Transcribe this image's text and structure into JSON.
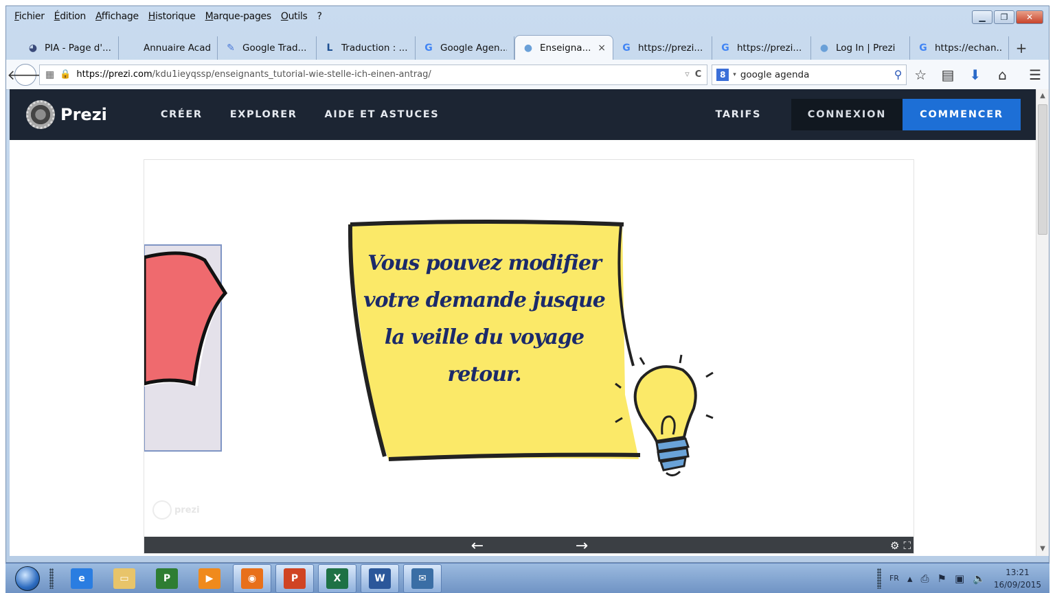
{
  "menubar": {
    "items": [
      "Fichier",
      "Édition",
      "Affichage",
      "Historique",
      "Marque-pages",
      "Outils",
      "?"
    ]
  },
  "tabs": [
    {
      "label": "PIA - Page d'...",
      "icon": "pia-icon",
      "icon_char": "◕",
      "icon_color": "#3a4a7a",
      "active": false
    },
    {
      "label": "Annuaire Acadé...",
      "icon": "none",
      "icon_char": "",
      "icon_color": "#000",
      "active": false
    },
    {
      "label": "Google Trad...",
      "icon": "google-translate-icon",
      "icon_char": "✎",
      "icon_color": "#4a78d8",
      "active": false
    },
    {
      "label": "Traduction : ...",
      "icon": "linguee-icon",
      "icon_char": "L",
      "icon_color": "#1d4f91",
      "active": false
    },
    {
      "label": "Google Agen...",
      "icon": "google-icon",
      "icon_char": "G",
      "icon_color": "#4285f4",
      "active": false
    },
    {
      "label": "Enseigna...",
      "icon": "globe-icon",
      "icon_char": "●",
      "icon_color": "#6aa0d8",
      "active": true
    },
    {
      "label": "https://prezi...",
      "icon": "google-icon",
      "icon_char": "G",
      "icon_color": "#4285f4",
      "active": false
    },
    {
      "label": "https://prezi...",
      "icon": "google-icon",
      "icon_char": "G",
      "icon_color": "#4285f4",
      "active": false
    },
    {
      "label": "Log In | Prezi",
      "icon": "globe-icon",
      "icon_char": "●",
      "icon_color": "#6aa0d8",
      "active": false
    },
    {
      "label": "https://echan...",
      "icon": "google-icon",
      "icon_char": "G",
      "icon_color": "#4285f4",
      "active": false
    }
  ],
  "tab_close": "×",
  "tab_new": "+",
  "navbar": {
    "url_domain": "https://prezi.com",
    "url_path": "/kdu1ieyqssp/enseignants_tutorial-wie-stelle-ich-einen-antrag/",
    "url_dropdown": "▿",
    "reload": "C",
    "search_engine_letter": "8",
    "search_value": "google agenda"
  },
  "prezi": {
    "logo_text": "Prezi",
    "nav": [
      "CRÉER",
      "EXPLORER",
      "AIDE ET ASTUCES"
    ],
    "tarifs": "TARIFS",
    "connexion": "CONNEXION",
    "commencer": "COMMENCER"
  },
  "slide": {
    "note_text": "Vous pouvez modifier votre demande jusque la veille du voyage retour.",
    "watermark": "prezi",
    "prev_arrow": "←",
    "next_arrow": "→"
  },
  "taskbar": {
    "apps": [
      {
        "name": "internet-explorer",
        "glyph": "e",
        "color": "#2a7de1"
      },
      {
        "name": "file-explorer",
        "glyph": "▭",
        "color": "#e8c46a"
      },
      {
        "name": "ms-project",
        "glyph": "P",
        "color": "#2e7d32"
      },
      {
        "name": "media-player",
        "glyph": "▶",
        "color": "#f08a1c"
      },
      {
        "name": "firefox",
        "glyph": "◉",
        "color": "#e8701a"
      },
      {
        "name": "powerpoint",
        "glyph": "P",
        "color": "#d04423"
      },
      {
        "name": "excel",
        "glyph": "X",
        "color": "#1e7145"
      },
      {
        "name": "word",
        "glyph": "W",
        "color": "#2b579a"
      },
      {
        "name": "thunderbird",
        "glyph": "✉",
        "color": "#3a6ea5"
      }
    ],
    "lang": "FR",
    "time": "13:21",
    "date": "16/09/2015"
  },
  "colors": {
    "prezi_header": "#1c2533",
    "commencer_blue": "#1d6fd6",
    "note_yellow": "#fbe968",
    "note_text": "#1b2a6a"
  }
}
